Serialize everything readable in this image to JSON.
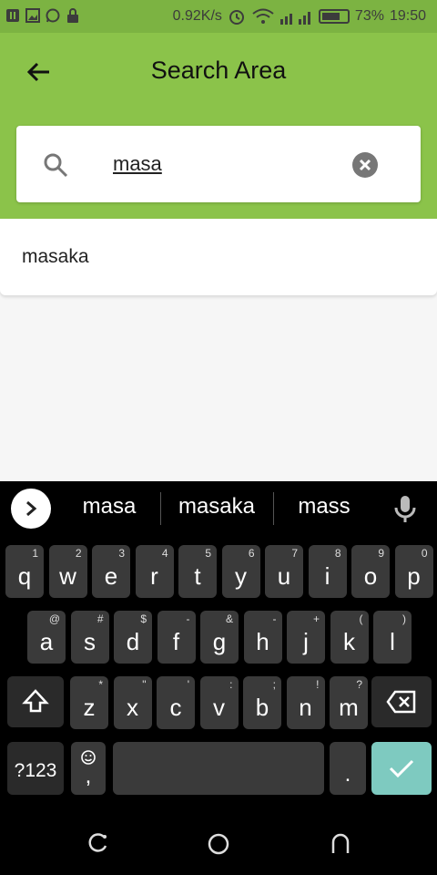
{
  "status_bar": {
    "speed": "0.92K/s",
    "battery_percent": "73%",
    "battery_level": 0.73,
    "time": "19:50"
  },
  "header": {
    "title": "Search Area",
    "back_icon": "arrow-left-icon"
  },
  "search": {
    "value": "masa",
    "search_icon": "search-icon",
    "clear_icon": "clear-circle-icon"
  },
  "suggestions": [
    "masaka"
  ],
  "keyboard": {
    "word_suggestions": [
      "masa",
      "masaka",
      "mass"
    ],
    "row1": [
      {
        "key": "q",
        "sup": "1"
      },
      {
        "key": "w",
        "sup": "2"
      },
      {
        "key": "e",
        "sup": "3"
      },
      {
        "key": "r",
        "sup": "4"
      },
      {
        "key": "t",
        "sup": "5"
      },
      {
        "key": "y",
        "sup": "6"
      },
      {
        "key": "u",
        "sup": "7"
      },
      {
        "key": "i",
        "sup": "8"
      },
      {
        "key": "o",
        "sup": "9"
      },
      {
        "key": "p",
        "sup": "0"
      }
    ],
    "row2": [
      {
        "key": "a",
        "sup": "@"
      },
      {
        "key": "s",
        "sup": "#"
      },
      {
        "key": "d",
        "sup": "$"
      },
      {
        "key": "f",
        "sup": "-"
      },
      {
        "key": "g",
        "sup": "&"
      },
      {
        "key": "h",
        "sup": "-"
      },
      {
        "key": "j",
        "sup": "+"
      },
      {
        "key": "k",
        "sup": "("
      },
      {
        "key": "l",
        "sup": ")"
      }
    ],
    "row3": [
      {
        "key": "z",
        "sup": "*"
      },
      {
        "key": "x",
        "sup": "\""
      },
      {
        "key": "c",
        "sup": "'"
      },
      {
        "key": "v",
        "sup": ":"
      },
      {
        "key": "b",
        "sup": ";"
      },
      {
        "key": "n",
        "sup": "!"
      },
      {
        "key": "m",
        "sup": "?"
      }
    ],
    "symbols_label": "?123",
    "comma_label": ",",
    "period_label": ".",
    "colors": {
      "action": "#7ecac0",
      "key": "#3a3a3a"
    }
  },
  "colors": {
    "appbar": "#8bc34a",
    "statusbar": "#7cb342"
  }
}
